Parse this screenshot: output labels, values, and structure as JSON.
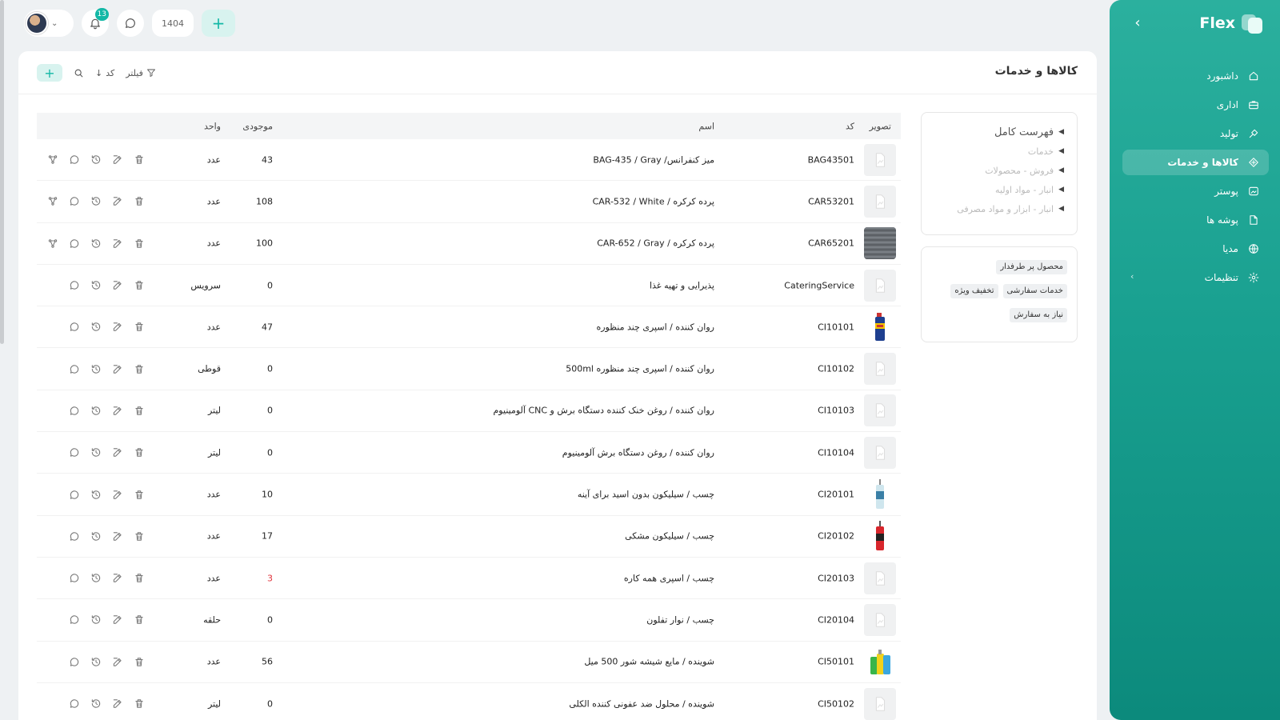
{
  "brand": {
    "name": "Flex"
  },
  "sidebar": {
    "items": [
      {
        "label": "داشبورد",
        "icon": "home-icon",
        "active": false,
        "expandable": false
      },
      {
        "label": "اداری",
        "icon": "briefcase-icon",
        "active": false,
        "expandable": false
      },
      {
        "label": "تولید",
        "icon": "production-icon",
        "active": false,
        "expandable": false
      },
      {
        "label": "کالاها و خدمات",
        "icon": "diamond-icon",
        "active": true,
        "expandable": false
      },
      {
        "label": "پوستر",
        "icon": "image-icon",
        "active": false,
        "expandable": false
      },
      {
        "label": "پوشه ها",
        "icon": "folder-icon",
        "active": false,
        "expandable": false
      },
      {
        "label": "مدیا",
        "icon": "globe-icon",
        "active": false,
        "expandable": false
      },
      {
        "label": "تنظیمات",
        "icon": "gear-icon",
        "active": false,
        "expandable": true
      }
    ]
  },
  "topbar": {
    "notifications_count": "13",
    "year": "1404"
  },
  "page": {
    "title": "کالاها و خدمات"
  },
  "toolbar": {
    "filter_label": "فیلتر",
    "sort_label": "کد"
  },
  "tree": {
    "root": "فهرست کامل",
    "items": [
      "خدمات",
      "فروش - محصولات",
      "انبار - مواد اولیه",
      "انبار - ابزار و مواد مصرفی"
    ]
  },
  "tags": [
    "محصول پر طرفدار",
    "خدمات سفارشی",
    "تخفیف ویژه",
    "نیاز به سفارش"
  ],
  "table": {
    "headers": {
      "image": "تصویر",
      "code": "کد",
      "name": "اسم",
      "stock": "موجودی",
      "unit": "واحد"
    },
    "rows": [
      {
        "code": "BAG43501",
        "name": "میز کنفرانس/ BAG-435 / Gray",
        "stock": "43",
        "unit": "عدد",
        "image": "placeholder",
        "variants": true,
        "negative": false
      },
      {
        "code": "CAR53201",
        "name": "پرده کرکره / CAR-532 / White",
        "stock": "108",
        "unit": "عدد",
        "image": "placeholder",
        "variants": true,
        "negative": false
      },
      {
        "code": "CAR65201",
        "name": "پرده کرکره / CAR-652 / Gray",
        "stock": "100",
        "unit": "عدد",
        "image": "blinds",
        "variants": true,
        "negative": false
      },
      {
        "code": "CateringService",
        "name": "پذیرایی و تهیه غذا",
        "stock": "0",
        "unit": "سرویس",
        "image": "placeholder",
        "variants": false,
        "negative": false
      },
      {
        "code": "CI10101",
        "name": "روان کننده / اسپری چند منظوره",
        "stock": "47",
        "unit": "عدد",
        "image": "spray-can",
        "variants": false,
        "negative": false
      },
      {
        "code": "CI10102",
        "name": "روان کننده / اسپری چند منظوره 500ml",
        "stock": "0",
        "unit": "قوطی",
        "image": "placeholder",
        "variants": false,
        "negative": false
      },
      {
        "code": "CI10103",
        "name": "روان کننده / روغن خنک کننده دستگاه برش و CNC آلومینیوم",
        "stock": "0",
        "unit": "لیتر",
        "image": "placeholder",
        "variants": false,
        "negative": false
      },
      {
        "code": "CI10104",
        "name": "روان کننده / روغن دستگاه برش آلومینیوم",
        "stock": "0",
        "unit": "لیتر",
        "image": "placeholder",
        "variants": false,
        "negative": false
      },
      {
        "code": "CI20101",
        "name": "چسب / سیلیکون بدون اسید برای آینه",
        "stock": "10",
        "unit": "عدد",
        "image": "silicone-tube-clear",
        "variants": false,
        "negative": false
      },
      {
        "code": "CI20102",
        "name": "چسب / سیلیکون مشکی",
        "stock": "17",
        "unit": "عدد",
        "image": "silicone-tube-red",
        "variants": false,
        "negative": false
      },
      {
        "code": "CI20103",
        "name": "چسب / اسپری همه کاره",
        "stock": "3",
        "unit": "عدد",
        "image": "placeholder",
        "variants": false,
        "negative": true
      },
      {
        "code": "CI20104",
        "name": "چسب / نوار تفلون",
        "stock": "0",
        "unit": "حلقه",
        "image": "placeholder",
        "variants": false,
        "negative": false
      },
      {
        "code": "CI50101",
        "name": "شوینده / مایع شیشه شور 500 میل",
        "stock": "56",
        "unit": "عدد",
        "image": "cleaner-bottles",
        "variants": false,
        "negative": false
      },
      {
        "code": "CI50102",
        "name": "شوینده / محلول ضد عفونی کننده الکلی",
        "stock": "0",
        "unit": "لیتر",
        "image": "placeholder",
        "variants": false,
        "negative": false
      }
    ]
  },
  "colors": {
    "accent": "#14b8a6",
    "sidebar": "#19a090",
    "negative": "#e0323a"
  }
}
